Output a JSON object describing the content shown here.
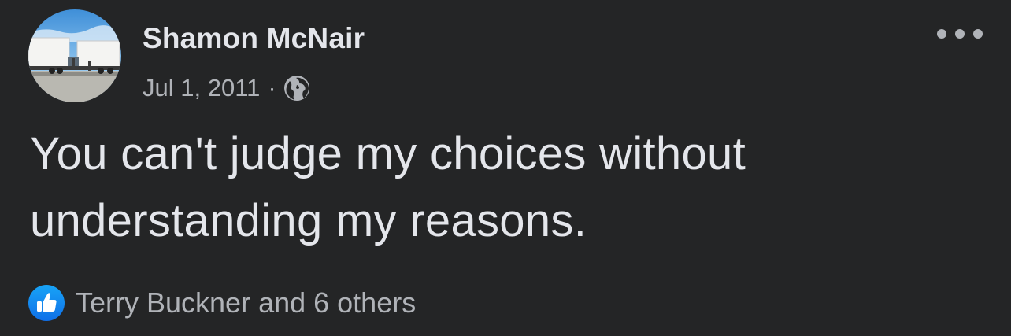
{
  "post": {
    "author": {
      "name": "Shamon McNair",
      "avatar": "profile-photo-trucks"
    },
    "meta": {
      "date": "Jul 1, 2011",
      "separator": "·",
      "audience_icon": "globe-icon"
    },
    "more_icon": "ellipsis-icon",
    "text": "You can't judge my choices without understanding my reasons.",
    "reactions": {
      "icon": "like-icon",
      "summary": "Terry Buckner and 6 others"
    }
  },
  "colors": {
    "background": "#242526",
    "primary_text": "#e4e6eb",
    "secondary_text": "#b0b3b8",
    "like_blue": "#1877f2"
  }
}
